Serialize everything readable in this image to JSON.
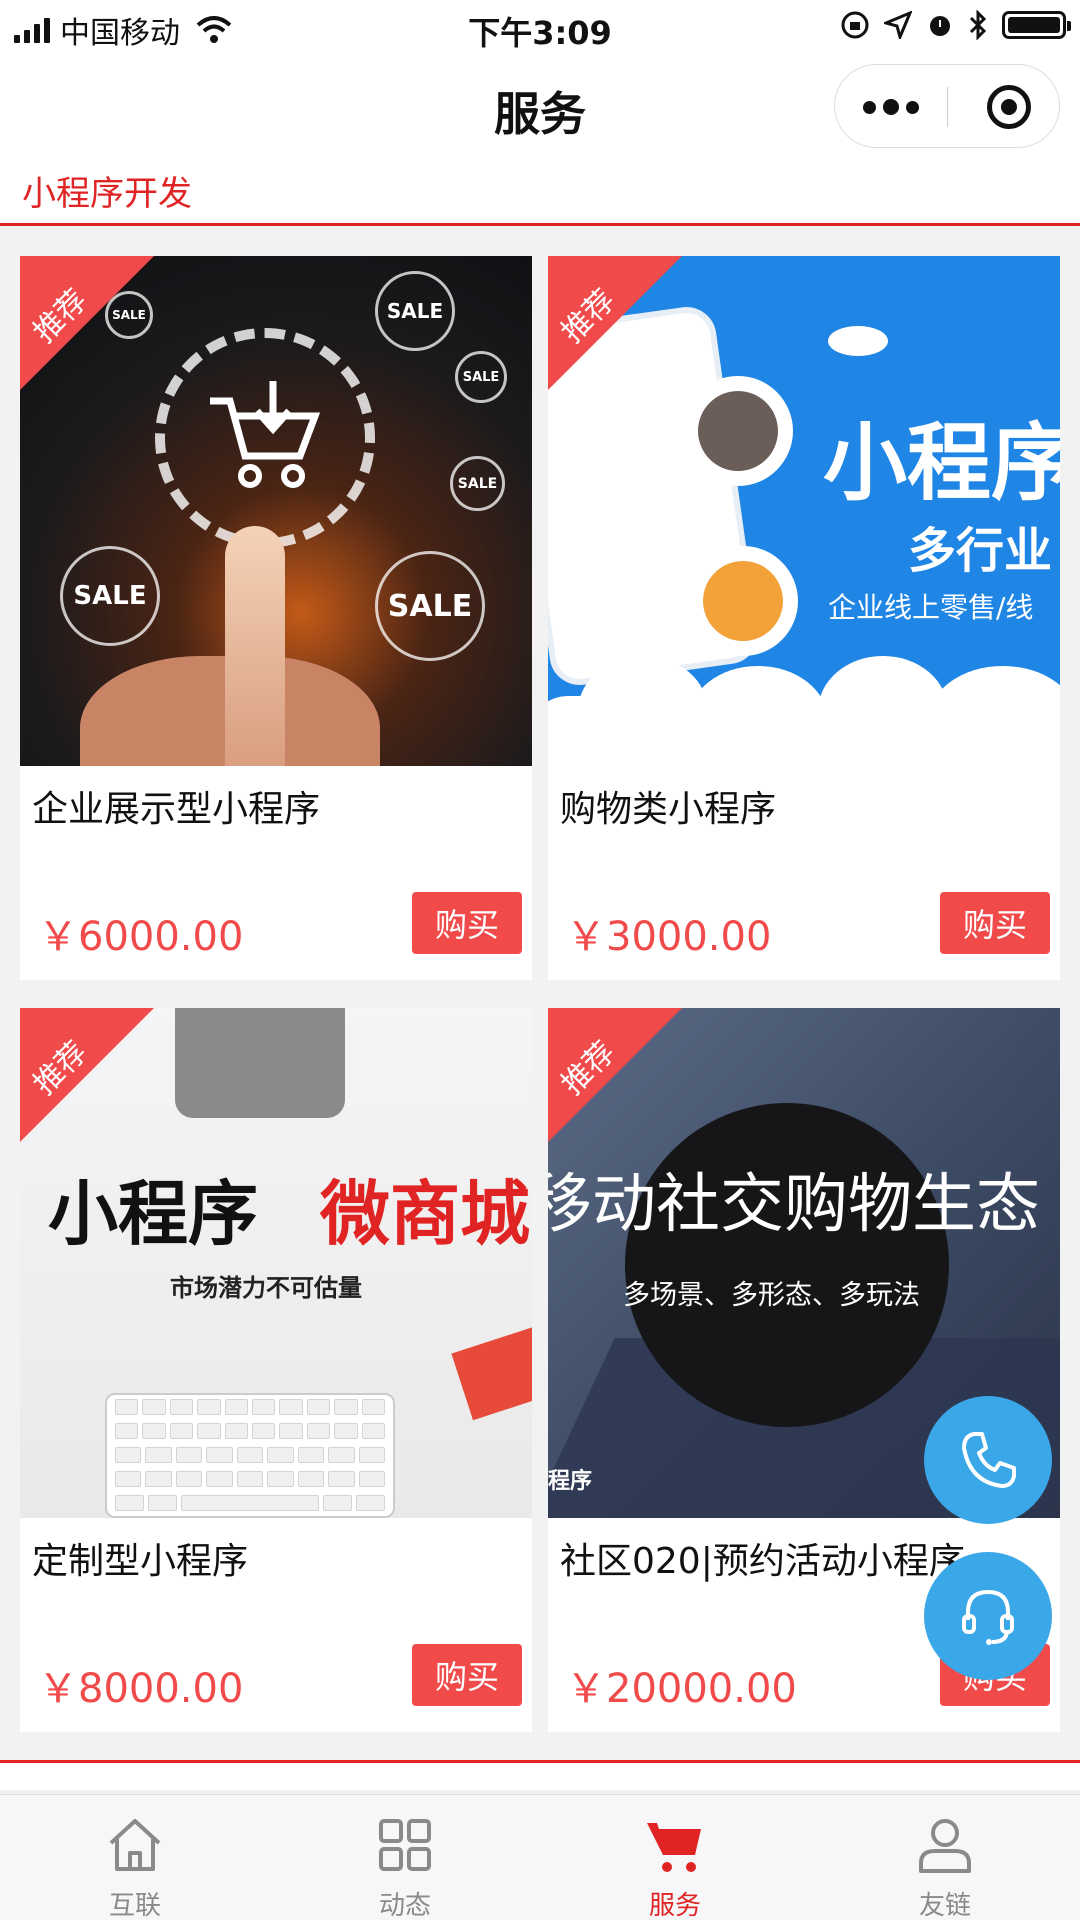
{
  "status_bar": {
    "carrier": "中国移动",
    "time": "下午3:09"
  },
  "nav": {
    "title": "服务"
  },
  "section": {
    "title": "小程序开发"
  },
  "ribbon_label": "推荐",
  "buy_label": "购买",
  "products": [
    {
      "name": "企业展示型小程序",
      "price": "￥6000.00"
    },
    {
      "name": "购物类小程序",
      "price": "￥3000.00"
    },
    {
      "name": "定制型小程序",
      "price": "￥8000.00"
    },
    {
      "name": "社区020|预约活动小程序",
      "price": "￥20000.00"
    }
  ],
  "images": {
    "img1": {
      "sale": "SALE"
    },
    "img2": {
      "headline": "小程序",
      "sub": "多行业",
      "line": "企业线上零售/线"
    },
    "img3": {
      "left": "小程序",
      "right": "微商城",
      "line": "市场潜力不可估量"
    },
    "img4": {
      "headline": "移动社交购物生态",
      "line": "多场景、多形态、多玩法",
      "corner": "程序"
    }
  },
  "tabs": [
    {
      "label": "互联",
      "icon": "home-icon"
    },
    {
      "label": "动态",
      "icon": "grid-icon"
    },
    {
      "label": "服务",
      "icon": "cart-icon"
    },
    {
      "label": "友链",
      "icon": "user-icon"
    }
  ],
  "colors": {
    "accent": "#e02424",
    "price": "#f04a4a",
    "fab": "#3aa7e8"
  }
}
